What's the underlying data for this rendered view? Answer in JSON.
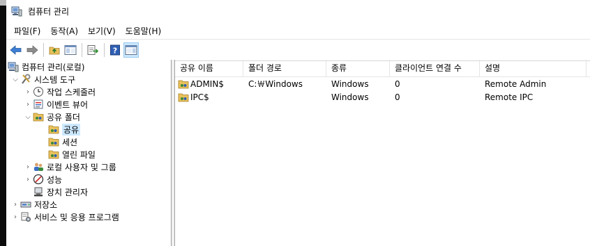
{
  "window": {
    "title": "컴퓨터 관리"
  },
  "menu": [
    {
      "id": "file",
      "label": "파일(F)"
    },
    {
      "id": "action",
      "label": "동작(A)"
    },
    {
      "id": "view",
      "label": "보기(V)"
    },
    {
      "id": "help",
      "label": "도움말(H)"
    }
  ],
  "toolbar": [
    {
      "name": "back-button",
      "icon": "arrow-left-icon"
    },
    {
      "name": "forward-button",
      "icon": "arrow-right-icon"
    },
    {
      "name": "up-folder-button",
      "icon": "folder-up-icon"
    },
    {
      "name": "show-hide-tree-button",
      "icon": "console-tree-icon"
    },
    {
      "name": "export-list-button",
      "icon": "export-icon"
    },
    {
      "name": "help-button",
      "icon": "help-icon"
    },
    {
      "name": "action-pane-button",
      "icon": "action-pane-icon"
    }
  ],
  "tree": {
    "root": "컴퓨터 관리(로컬)",
    "system_tools": "시스템 도구",
    "task_scheduler": "작업 스케줄러",
    "event_viewer": "이벤트 뷰어",
    "shared_folders": "공유 폴더",
    "shares": "공유",
    "sessions": "세션",
    "open_files": "열린 파일",
    "local_users": "로컬 사용자 및 그룹",
    "performance": "성능",
    "device_manager": "장치 관리자",
    "storage": "저장소",
    "services_apps": "서비스 및 응용 프로그램"
  },
  "list": {
    "columns": [
      "공유 이름",
      "폴더 경로",
      "종류",
      "클라이언트 연결 수",
      "설명"
    ],
    "rows": [
      {
        "name": "ADMIN$",
        "path": "C:￦Windows",
        "type": "Windows",
        "clients": "0",
        "desc": "Remote Admin"
      },
      {
        "name": "IPC$",
        "path": "",
        "type": "Windows",
        "clients": "0",
        "desc": "Remote IPC"
      }
    ]
  },
  "colors": {
    "selection": "#cce8ff",
    "border": "#a0a0a0"
  }
}
